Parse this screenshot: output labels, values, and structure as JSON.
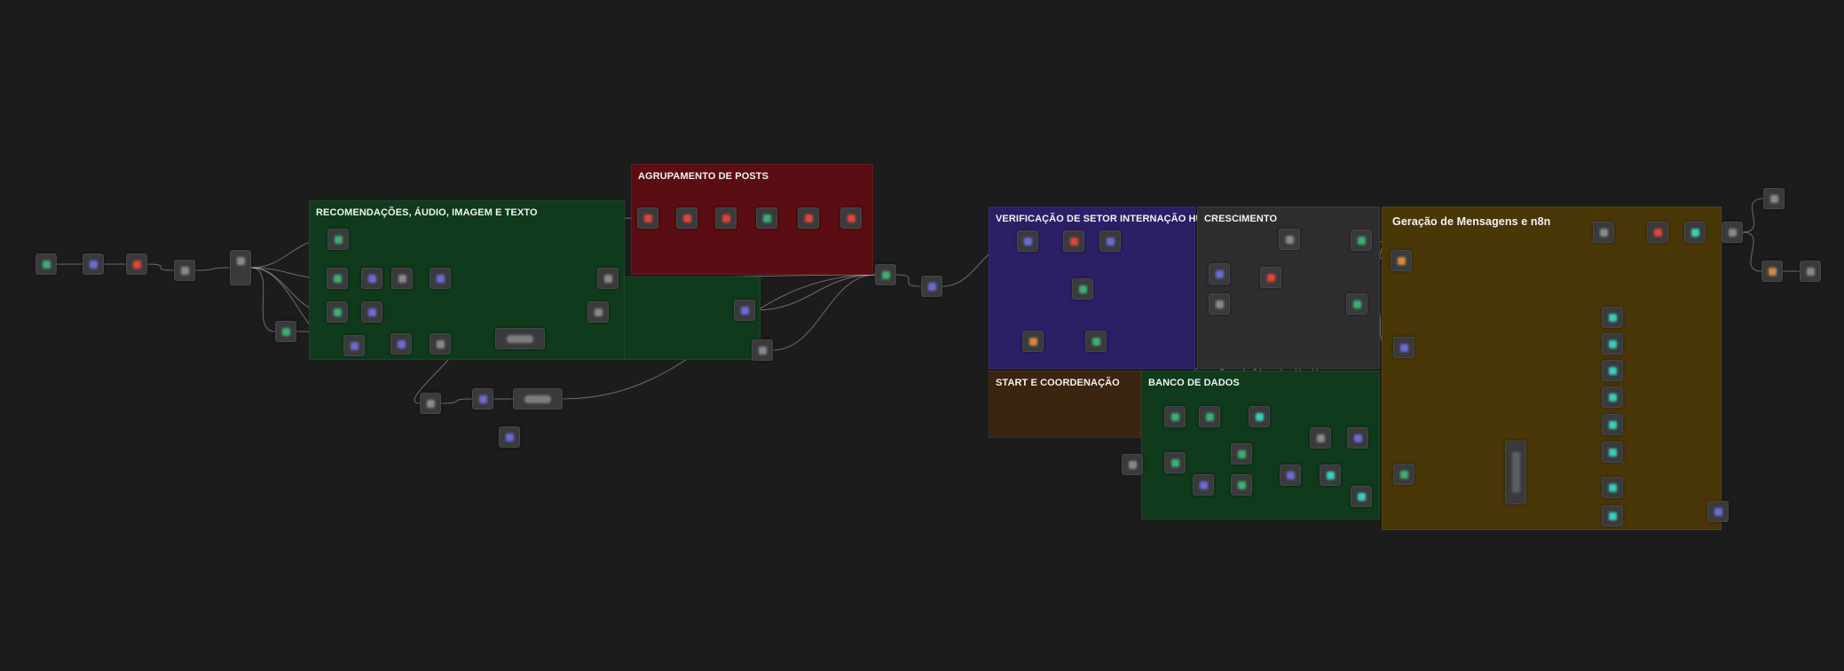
{
  "canvas": {
    "background": "#1c1c1d"
  },
  "groups": [
    {
      "id": "g-recomendacoes",
      "label": "RECOMENDAÇÕES, ÁUDIO, IMAGEM E TEXTO",
      "color": "#0f3a1b"
    },
    {
      "id": "g-agrupamento",
      "label": "AGRUPAMENTO DE POSTS",
      "color": "#5a0d12"
    },
    {
      "id": "g-verificacao",
      "label": "VERIFICAÇÃO DE SETOR INTERNAÇÃO HUMANA",
      "color": "#2c1f66"
    },
    {
      "id": "g-crescimento",
      "label": "CRESCIMENTO",
      "color": "#2e2e30"
    },
    {
      "id": "g-start",
      "label": "START E COORDENAÇÃO",
      "color": "#3b2410"
    },
    {
      "id": "g-banco",
      "label": "BANCO DE DADOS",
      "color": "#0f3a1b"
    },
    {
      "id": "g-geracao",
      "label": "Geração de Mensagens e n8n",
      "color": "#4a3708"
    }
  ],
  "node_colors": {
    "green": "#3fae73",
    "blue": "#6b6bd6",
    "red": "#e0443a",
    "teal": "#38d0b8",
    "orange": "#d58a3a",
    "gray": "#8a8a8a"
  }
}
